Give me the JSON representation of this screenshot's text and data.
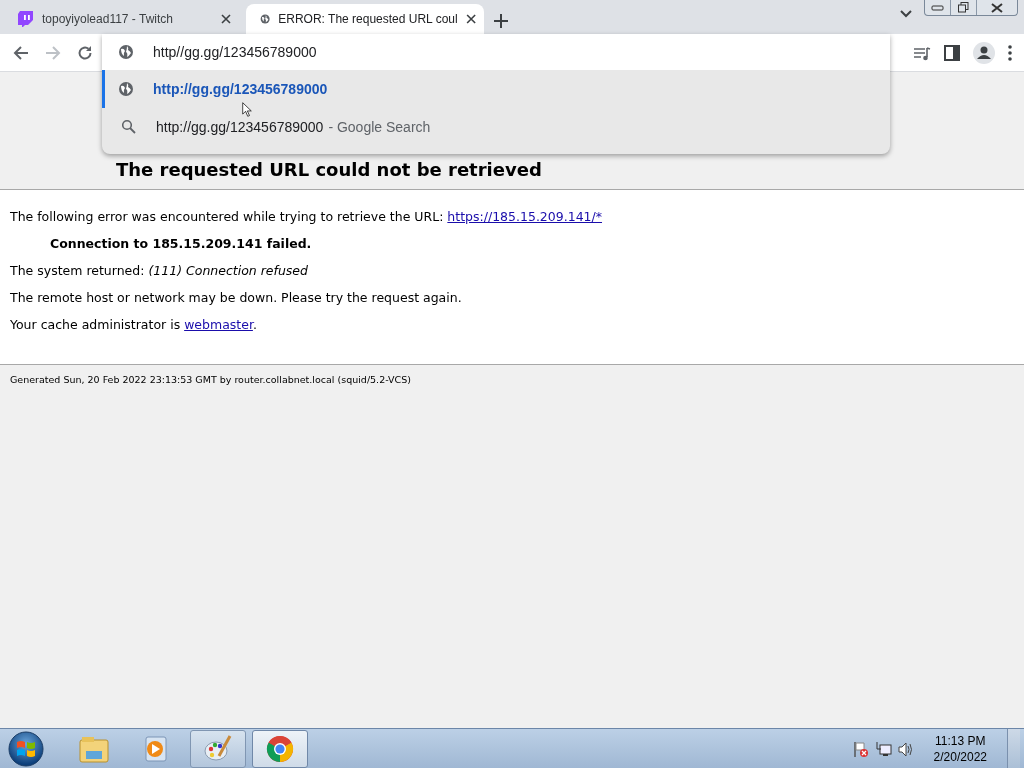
{
  "browser": {
    "tabs": [
      {
        "title": "topoyiyolead117 - Twitch",
        "kind": "twitch",
        "selected": false
      },
      {
        "title": "ERROR: The requested URL coul",
        "kind": "globe",
        "selected": true
      }
    ],
    "omnibox": {
      "value": "http//gg.gg/123456789000"
    },
    "suggestions": [
      {
        "kind": "url",
        "text": "http://gg.gg/123456789000",
        "selected": true
      },
      {
        "kind": "search",
        "text": "http://gg.gg/123456789000",
        "suffix": "- Google Search",
        "selected": false
      }
    ]
  },
  "page": {
    "heading": "The requested URL could not be retrieved",
    "intro": "The following error was encountered while trying to retrieve the URL:",
    "intro_link": "https://185.15.209.141/*",
    "error": "Connection to 185.15.209.141 failed.",
    "system_returned": "The system returned: *(111) Connection refused*",
    "remote": "The remote host or network may be down. Please try the request again.",
    "admin": "Your cache administrator is",
    "admin_link": "webmaster",
    "admin_end": ".",
    "footer": "Generated Sun, 20 Feb 2022 23:13:53 GMT by router.collabnet.local (squid/5.2-VCS)"
  },
  "taskbar": {
    "buttons": [
      {
        "kind": "explorer",
        "running": false,
        "selected": false
      },
      {
        "kind": "media",
        "running": false,
        "selected": false
      },
      {
        "kind": "paint",
        "running": true,
        "selected": false
      },
      {
        "kind": "chrome",
        "running": true,
        "selected": true
      }
    ],
    "clock": {
      "time": "11:13 PM",
      "date": "2/20/2022"
    }
  }
}
